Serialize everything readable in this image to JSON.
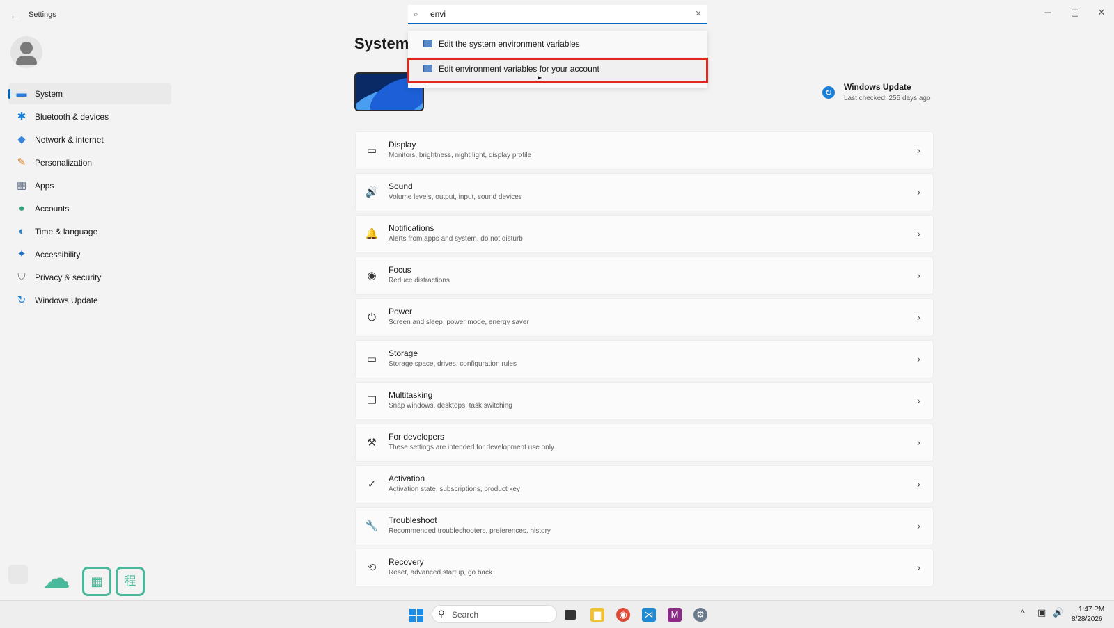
{
  "window": {
    "title": "Settings",
    "back_icon": "back-arrow-icon",
    "controls": {
      "minimize": "─",
      "maximize": "▢",
      "close": "✕"
    }
  },
  "search": {
    "value": "envi",
    "placeholder": "",
    "clear_glyph": "✕",
    "results": [
      {
        "label": "Edit the system environment variables"
      },
      {
        "label": "Edit environment variables for your account"
      }
    ]
  },
  "sidebar": {
    "items": [
      {
        "label": "System",
        "icon": "system-icon",
        "glyph": "▬",
        "color": "#2a7fd4"
      },
      {
        "label": "Bluetooth & devices",
        "icon": "bluetooth-icon",
        "glyph": "✱",
        "color": "#1a7fd8"
      },
      {
        "label": "Network & internet",
        "icon": "wifi-icon",
        "glyph": "◆",
        "color": "#3a86d8"
      },
      {
        "label": "Personalization",
        "icon": "brush-icon",
        "glyph": "✎",
        "color": "#d9822b"
      },
      {
        "label": "Apps",
        "icon": "apps-icon",
        "glyph": "▦",
        "color": "#5a6a80"
      },
      {
        "label": "Accounts",
        "icon": "accounts-icon",
        "glyph": "●",
        "color": "#2fa37a"
      },
      {
        "label": "Time & language",
        "icon": "globe-icon",
        "glyph": "◐",
        "color": "#2a86d0"
      },
      {
        "label": "Accessibility",
        "icon": "accessibility-icon",
        "glyph": "✦",
        "color": "#1a6fc8"
      },
      {
        "label": "Privacy & security",
        "icon": "shield-icon",
        "glyph": "⛉",
        "color": "#6a6a6a"
      },
      {
        "label": "Windows Update",
        "icon": "update-icon",
        "glyph": "↻",
        "color": "#1a7fd8"
      }
    ]
  },
  "main": {
    "title": "System",
    "windows_update": {
      "title": "Windows Update",
      "subtitle": "Last checked: 255 days ago",
      "glyph": "↻"
    },
    "cards": [
      {
        "title": "Display",
        "subtitle": "Monitors, brightness, night light, display profile",
        "icon": "display-icon",
        "glyph": "▭"
      },
      {
        "title": "Sound",
        "subtitle": "Volume levels, output, input, sound devices",
        "icon": "sound-icon",
        "glyph": "🔊"
      },
      {
        "title": "Notifications",
        "subtitle": "Alerts from apps and system, do not disturb",
        "icon": "bell-icon",
        "glyph": "🔔"
      },
      {
        "title": "Focus",
        "subtitle": "Reduce distractions",
        "icon": "focus-icon",
        "glyph": "◉"
      },
      {
        "title": "Power",
        "subtitle": "Screen and sleep, power mode, energy saver",
        "icon": "power-icon",
        "glyph": "⏻"
      },
      {
        "title": "Storage",
        "subtitle": "Storage space, drives, configuration rules",
        "icon": "storage-icon",
        "glyph": "▭"
      },
      {
        "title": "Multitasking",
        "subtitle": "Snap windows, desktops, task switching",
        "icon": "multitasking-icon",
        "glyph": "❐"
      },
      {
        "title": "For developers",
        "subtitle": "These settings are intended for development use only",
        "icon": "developer-icon",
        "glyph": "⚒"
      },
      {
        "title": "Activation",
        "subtitle": "Activation state, subscriptions, product key",
        "icon": "activation-icon",
        "glyph": "✓"
      },
      {
        "title": "Troubleshoot",
        "subtitle": "Recommended troubleshooters, preferences, history",
        "icon": "wrench-icon",
        "glyph": "🔧"
      },
      {
        "title": "Recovery",
        "subtitle": "Reset, advanced startup, go back",
        "icon": "recovery-icon",
        "glyph": "⟲"
      }
    ],
    "chevron": "›"
  },
  "widgets": {
    "cloud_glyph": "☁",
    "grid_glyph": "▦",
    "cal_glyph": "程"
  },
  "taskbar": {
    "search_label": "Search",
    "search_glyph": "⚲",
    "apps": {
      "explorer": "▆",
      "chrome": "◉",
      "vscode": "⋊",
      "m": "M",
      "settings": "⚙"
    },
    "tray": {
      "chevron": "^",
      "net": "▣",
      "vol": "🔊"
    },
    "time": "1:47 PM",
    "date": "8/28/2026"
  },
  "colors": {
    "accent": "#0067c0",
    "highlight": "#e0281e",
    "widget": "#4ab89a"
  }
}
